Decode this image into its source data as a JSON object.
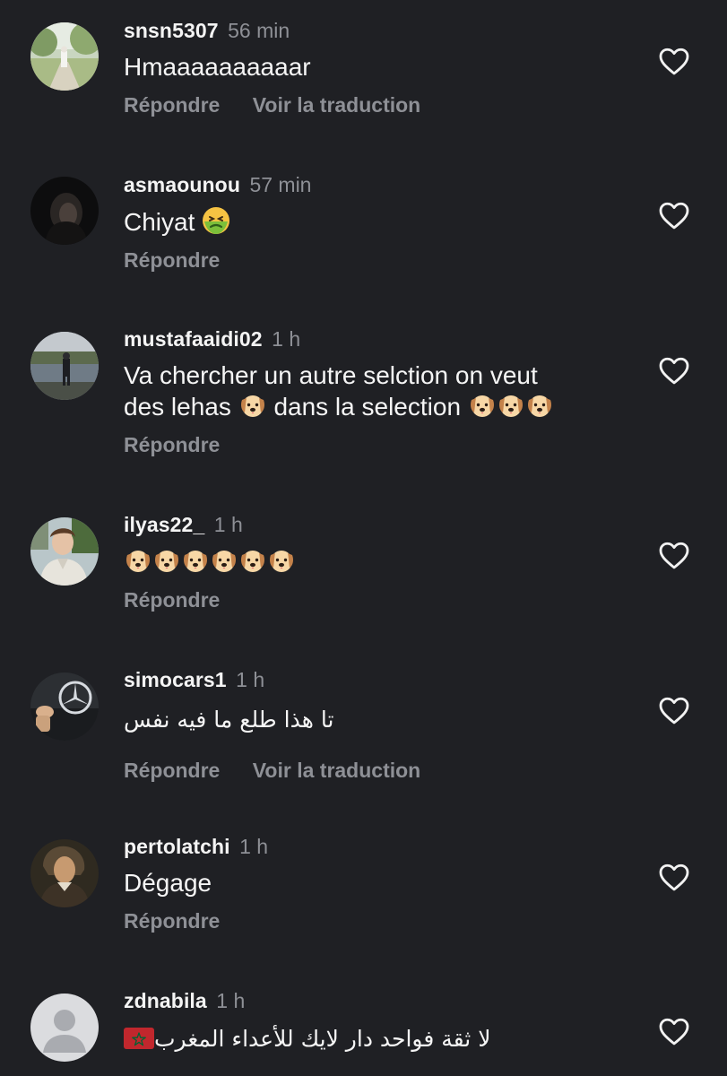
{
  "icons": {
    "like": "heart-outline-icon",
    "avatar_placeholder": "default-avatar-icon"
  },
  "colors": {
    "background": "#1f2024",
    "text": "#f5f5f5",
    "secondary": "#8e9096"
  },
  "comments": [
    {
      "username": "snsn5307",
      "time": "56 min",
      "text": "Hmaaaaaaaaaar",
      "actions": [
        "Répondre",
        "Voir la traduction"
      ]
    },
    {
      "username": "asmaounou",
      "time": "57 min",
      "text": "Chiyat",
      "emoji": "nauseated-face-emoji",
      "actions": [
        "Répondre"
      ]
    },
    {
      "username": "mustafaaidi02",
      "time": "1 h",
      "text_part1": "Va chercher un autre selction on veut",
      "text_part2": "des lehas",
      "text_part3": "dans la selection",
      "emoji": "dog-face-emoji",
      "actions": [
        "Répondre"
      ]
    },
    {
      "username": "ilyas22_",
      "time": "1 h",
      "emoji": "dog-face-emoji",
      "emoji_count": 6,
      "actions": [
        "Répondre"
      ]
    },
    {
      "username": "simocars1",
      "time": "1 h",
      "text": "تا هذا طلع ما فيه نفس",
      "actions": [
        "Répondre",
        "Voir la traduction"
      ]
    },
    {
      "username": "pertolatchi",
      "time": "1 h",
      "text": "Dégage",
      "actions": [
        "Répondre"
      ]
    },
    {
      "username": "zdnabila",
      "time": "1 h",
      "text": "لا ثقة فواحد دار لايك للأعداء المغرب",
      "emoji": "morocco-flag-emoji"
    }
  ]
}
